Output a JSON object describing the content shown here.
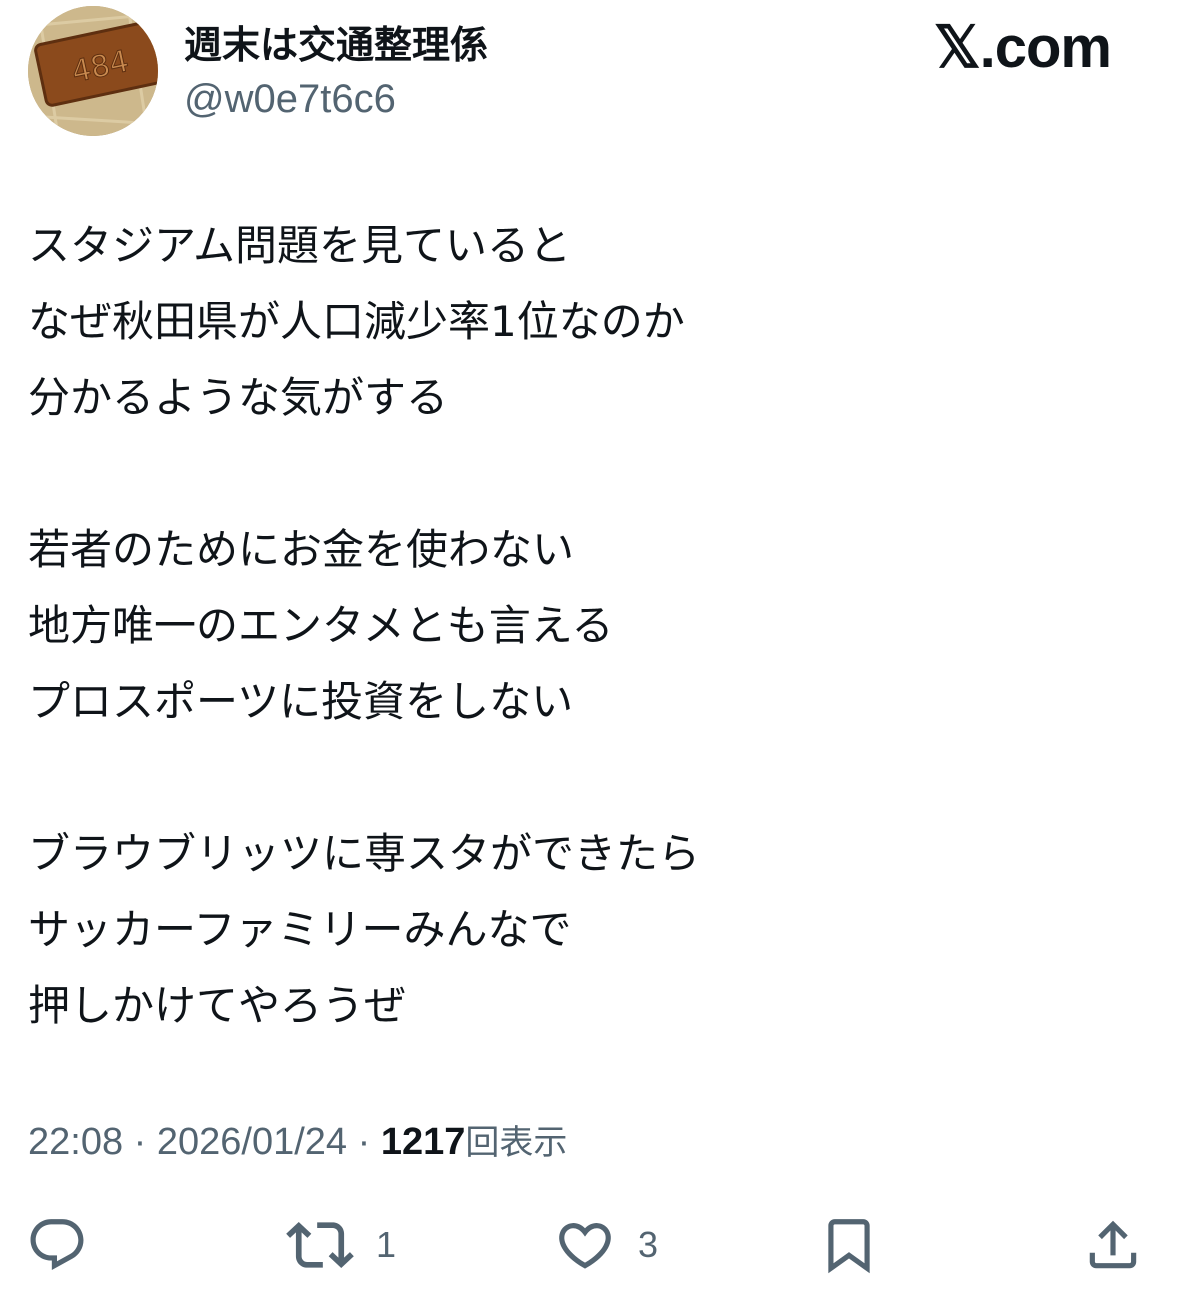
{
  "author": {
    "display_name": "週末は交通整理係",
    "handle": "@w0e7t6c6",
    "avatar_icon": "carved-wood-plaque-avatar"
  },
  "brand": {
    "x_glyph": "𝕏",
    "suffix": ".com"
  },
  "tweet": {
    "paragraphs": [
      [
        "スタジアム問題を見ていると",
        "なぜ秋田県が人口減少率1位なのか",
        "分かるような気がする"
      ],
      [
        "若者のためにお金を使わない",
        "地方唯一のエンタメとも言える",
        "プロスポーツに投資をしない"
      ],
      [
        "ブラウブリッツに専スタができたら",
        "サッカーファミリーみんなで",
        "押しかけてやろうぜ"
      ]
    ]
  },
  "meta": {
    "time": "22:08",
    "separator": "·",
    "date": "2026/01/24",
    "views_count": "1217",
    "views_label": "回表示"
  },
  "actions": {
    "reply": {
      "icon": "reply-icon",
      "count": ""
    },
    "repost": {
      "icon": "repost-icon",
      "count": "1"
    },
    "like": {
      "icon": "heart-icon",
      "count": "3"
    },
    "bookmark": {
      "icon": "bookmark-icon",
      "count": ""
    },
    "share": {
      "icon": "share-icon",
      "count": ""
    }
  },
  "colors": {
    "text_primary": "#0f1419",
    "text_secondary": "#536471",
    "background": "#ffffff"
  }
}
